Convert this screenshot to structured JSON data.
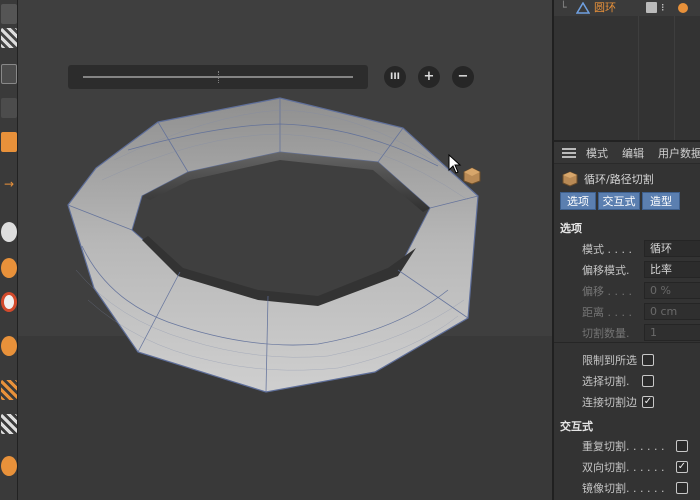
{
  "viewport": {
    "slider_buttons": {
      "pause_glyph": "III",
      "plus_glyph": "+",
      "minus_glyph": "−"
    }
  },
  "object_manager": {
    "selected_object": "圆环"
  },
  "attributes": {
    "menu": [
      "模式",
      "编辑",
      "用户数据"
    ],
    "tool_title": "循环/路径切割",
    "tabs": [
      "选项",
      "交互式",
      "造型"
    ],
    "options_section": "选项",
    "options": [
      {
        "label": "模式 . . . .",
        "value": "循环",
        "dim": false
      },
      {
        "label": "偏移模式.",
        "value": "比率",
        "dim": false
      },
      {
        "label": "偏移 . . . .",
        "value": "0 %",
        "dim": true
      },
      {
        "label": "距离 . . . .",
        "value": "0 cm",
        "dim": true
      },
      {
        "label": "切割数量.",
        "value": "1",
        "dim": true
      }
    ],
    "checks": [
      {
        "label": "限制到所选",
        "checked": false
      },
      {
        "label": "选择切割.",
        "checked": false
      },
      {
        "label": "连接切割边",
        "checked": true
      }
    ],
    "interactive_section": "交互式",
    "interactive_checks": [
      {
        "label": "重复切割. . . . . .",
        "checked": false
      },
      {
        "label": "双向切割. . . . . .",
        "checked": true
      },
      {
        "label": "镜像切割. . . . . .",
        "checked": false
      }
    ]
  },
  "colors": {
    "accent_orange": "#e8913a",
    "tab_blue": "#5b7fb0",
    "viewport_bg": "#3f3f3f"
  }
}
